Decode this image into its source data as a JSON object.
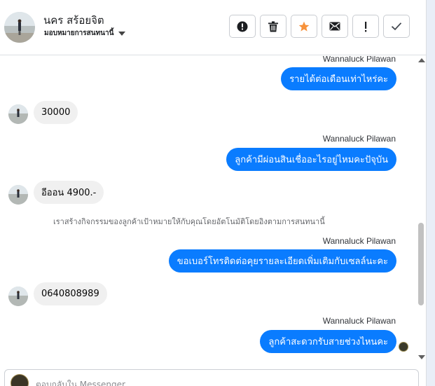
{
  "header": {
    "contact_name": "นคร สร้อยจิต",
    "assign_label": "มอบหมายการสนทนานี้"
  },
  "actions": [
    {
      "icon": "alert-circle-icon",
      "label": "mark-spam"
    },
    {
      "icon": "trash-icon",
      "label": "delete"
    },
    {
      "icon": "star-icon",
      "label": "follow-up"
    },
    {
      "icon": "envelope-icon",
      "label": "mark-unread"
    },
    {
      "icon": "exclamation-icon",
      "label": "priority"
    },
    {
      "icon": "check-icon",
      "label": "done"
    }
  ],
  "colors": {
    "outgoing_bubble": "#0a7cff",
    "incoming_bubble": "#f0f0f0",
    "star": "#f7923b"
  },
  "messages": [
    {
      "type": "outgoing",
      "sender": "Wannaluck Pilawan",
      "text": "รายได้ต่อเดือนเท่าไหร่คะ"
    },
    {
      "type": "incoming",
      "text": "30000"
    },
    {
      "type": "outgoing",
      "sender": "Wannaluck Pilawan",
      "text": "ลูกค้ามีผ่อนสินเชื่ออะไรอยู่ไหมคะปัจุบัน"
    },
    {
      "type": "incoming",
      "text": "อีออน 4900.-"
    },
    {
      "type": "system",
      "text": "เราสร้างกิจกรรมของลูกค้าเป้าหมายให้กับคุณโดยอัตโนมัติโดยอิงตามการสนทนานี้"
    },
    {
      "type": "outgoing",
      "sender": "Wannaluck Pilawan",
      "text": "ขอเบอร์โทรติดต่อคุยรายละเอียดเพิ่มเติมกับเซลล์นะคะ"
    },
    {
      "type": "incoming",
      "text": "0640808989"
    },
    {
      "type": "outgoing",
      "sender": "Wannaluck Pilawan",
      "text": "ลูกค้าสะดวกรับสายช่วงไหนคะ"
    }
  ],
  "composer": {
    "placeholder": "ตอบกลับใน Messenger"
  }
}
